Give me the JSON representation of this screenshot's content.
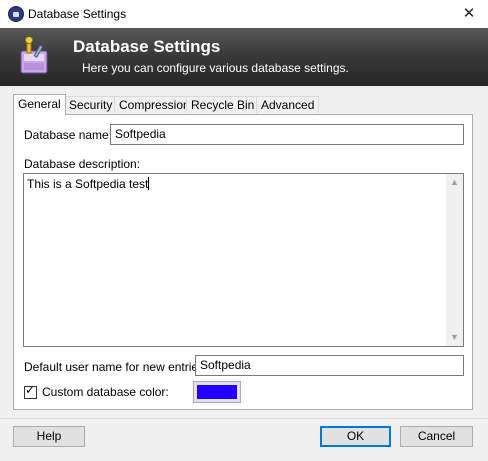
{
  "window": {
    "title": "Database Settings",
    "close_glyph": "✕"
  },
  "banner": {
    "title": "Database Settings",
    "subtitle": "Here you can configure various database settings.",
    "icon": "database-settings-icon"
  },
  "tabs": [
    {
      "label": "General",
      "active": true
    },
    {
      "label": "Security"
    },
    {
      "label": "Compression"
    },
    {
      "label": "Recycle Bin"
    },
    {
      "label": "Advanced"
    }
  ],
  "general": {
    "name_label": "Database name:",
    "name_value": "Softpedia",
    "description_label": "Database description:",
    "description_value": "This is a Softpedia test",
    "default_user_label": "Default user name for new entries:",
    "default_user_value": "Softpedia",
    "custom_color_label": "Custom database color:",
    "custom_color_checked": true,
    "custom_color_value": "#2200ff"
  },
  "buttons": {
    "help": "Help",
    "ok": "OK",
    "cancel": "Cancel"
  }
}
